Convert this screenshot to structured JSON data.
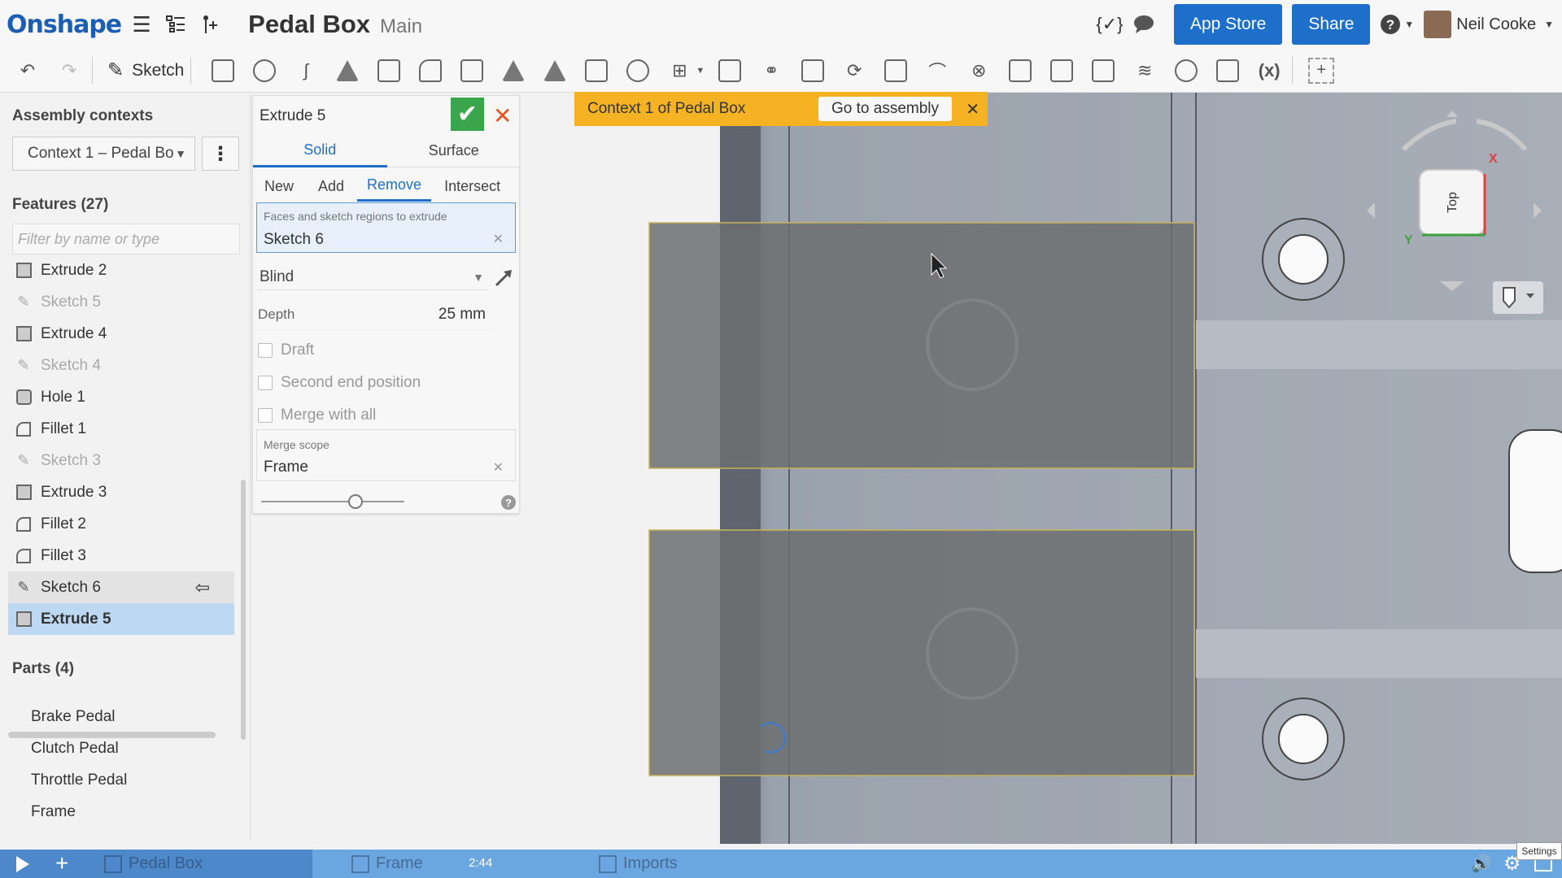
{
  "header": {
    "logo": "Onshape",
    "doc_title": "Pedal Box",
    "branch": "Main",
    "app_store": "App Store",
    "share": "Share",
    "user_name": "Neil Cooke"
  },
  "toolbar": {
    "sketch_label": "Sketch",
    "variable_label": "(x)"
  },
  "left": {
    "contexts_title": "Assembly contexts",
    "context_value": "Context 1 – Pedal Bo",
    "features_title": "Features (27)",
    "filter_placeholder": "Filter by name or type",
    "features": [
      {
        "label": "Extrude 2",
        "kind": "extrude",
        "state": "normal"
      },
      {
        "label": "Sketch 5",
        "kind": "sketch",
        "state": "dim"
      },
      {
        "label": "Extrude 4",
        "kind": "extrude",
        "state": "normal"
      },
      {
        "label": "Sketch 4",
        "kind": "sketch",
        "state": "dim"
      },
      {
        "label": "Hole 1",
        "kind": "hole",
        "state": "normal"
      },
      {
        "label": "Fillet 1",
        "kind": "fillet",
        "state": "normal"
      },
      {
        "label": "Sketch 3",
        "kind": "sketch",
        "state": "dim"
      },
      {
        "label": "Extrude 3",
        "kind": "extrude",
        "state": "normal"
      },
      {
        "label": "Fillet 2",
        "kind": "fillet",
        "state": "normal"
      },
      {
        "label": "Fillet 3",
        "kind": "fillet",
        "state": "normal"
      },
      {
        "label": "Sketch 6",
        "kind": "sketch",
        "state": "highlight"
      },
      {
        "label": "Extrude 5",
        "kind": "extrude",
        "state": "selected"
      }
    ],
    "parts_title": "Parts (4)",
    "parts": [
      "Brake Pedal",
      "Clutch Pedal",
      "Throttle Pedal",
      "Frame"
    ]
  },
  "dialog": {
    "title": "Extrude 5",
    "type_tabs": [
      "Solid",
      "Surface"
    ],
    "op_tabs": [
      "New",
      "Add",
      "Remove",
      "Intersect"
    ],
    "faces_label": "Faces and sketch regions to extrude",
    "faces_value": "Sketch 6",
    "end_type": "Blind",
    "depth_label": "Depth",
    "depth_value": "25 mm",
    "draft_label": "Draft",
    "second_end_label": "Second end position",
    "merge_all_label": "Merge with all",
    "merge_scope_label": "Merge scope",
    "merge_scope_value": "Frame",
    "help": "?"
  },
  "banner": {
    "text": "Context 1 of Pedal Box",
    "goto": "Go to assembly"
  },
  "viewcube": {
    "face": "Top",
    "x_axis": "X",
    "y_axis": "Y"
  },
  "bottom": {
    "tabs": [
      "Pedal Box",
      "Frame",
      "Imports"
    ],
    "time": "2:44",
    "settings_tip": "Settings",
    "progress": 0.2
  },
  "colors": {
    "brand": "#1e6fc9",
    "ok": "#3aa54a",
    "cancel": "#e8541c",
    "banner": "#f5b324",
    "selection": "#bcd8f2"
  }
}
